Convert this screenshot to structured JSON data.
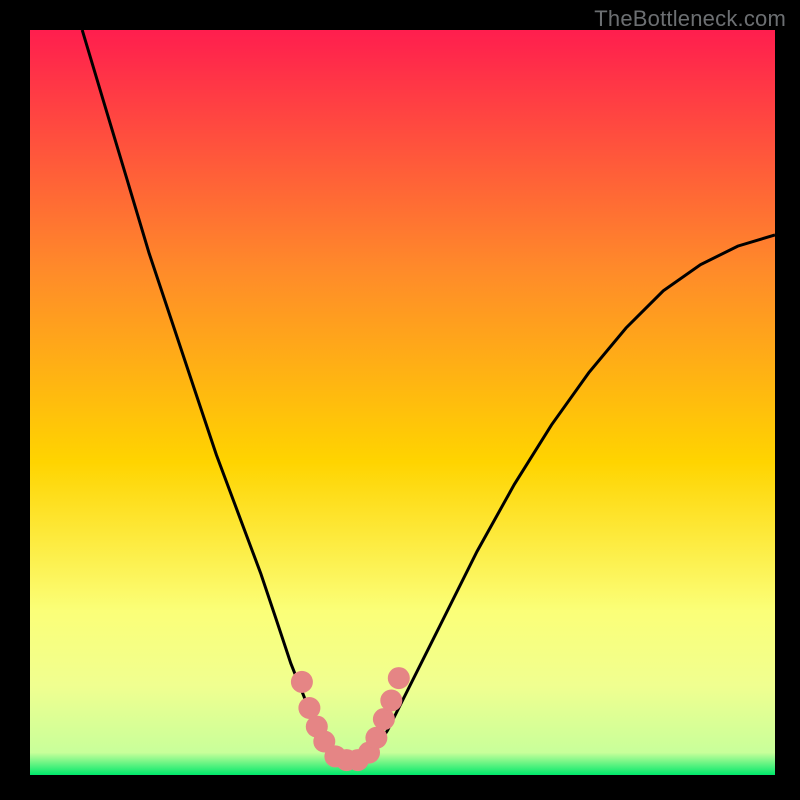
{
  "watermark": "TheBottleneck.com",
  "colors": {
    "bg": "#000000",
    "gradient_top": "#ff1e4e",
    "gradient_mid_upper": "#ff8a2a",
    "gradient_mid": "#ffd400",
    "gradient_mid_lower": "#fbff78",
    "gradient_band": "#f0ff90",
    "gradient_green": "#00e86b",
    "curve": "#000000",
    "marker": "#e58585"
  },
  "chart_data": {
    "type": "line",
    "title": "",
    "xlabel": "",
    "ylabel": "",
    "xlim": [
      0,
      100
    ],
    "ylim": [
      0,
      100
    ],
    "series": [
      {
        "name": "bottleneck-curve",
        "x": [
          7,
          10,
          13,
          16,
          19,
          22,
          25,
          28,
          31,
          33,
          35,
          37,
          39,
          40.5,
          42,
          44,
          46,
          48,
          50,
          55,
          60,
          65,
          70,
          75,
          80,
          85,
          90,
          95,
          100
        ],
        "y": [
          100,
          90,
          80,
          70,
          61,
          52,
          43,
          35,
          27,
          21,
          15,
          10,
          6,
          3.5,
          2,
          2,
          3,
          6,
          10,
          20,
          30,
          39,
          47,
          54,
          60,
          65,
          68.5,
          71,
          72.5
        ]
      }
    ],
    "markers": {
      "name": "highlighted-range",
      "x": [
        36.5,
        37.5,
        38.5,
        39.5,
        41,
        42.5,
        44,
        45.5,
        46.5,
        47.5,
        48.5,
        49.5
      ],
      "y": [
        12.5,
        9,
        6.5,
        4.5,
        2.5,
        2,
        2,
        3,
        5,
        7.5,
        10,
        13
      ]
    }
  }
}
